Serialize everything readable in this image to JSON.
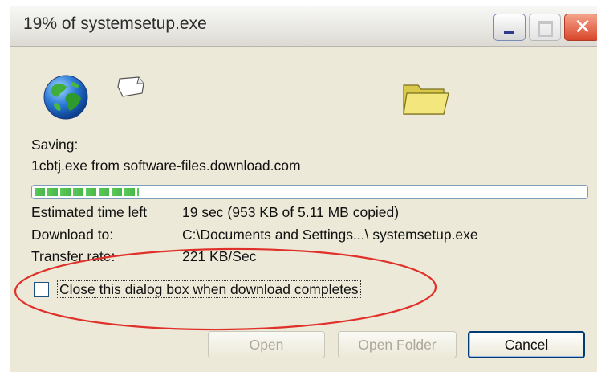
{
  "window": {
    "title": "19% of systemsetup.exe",
    "controls": {
      "minimize": "minimize",
      "maximize": "maximize",
      "close": "✕"
    }
  },
  "status": {
    "saving_label": "Saving:",
    "source": "1cbtj.exe from software-files.download.com",
    "progress_fraction": 0.19
  },
  "details": {
    "time_left_label": "Estimated time left",
    "time_left_value": "19 sec (953 KB of 5.11 MB copied)",
    "download_to_label": "Download to:",
    "download_to_value": "C:\\Documents and Settings...\\ systemsetup.exe",
    "transfer_rate_label": "Transfer rate:",
    "transfer_rate_value": "221 KB/Sec"
  },
  "options": {
    "close_when_done_label": "Close this dialog box when download completes",
    "close_when_done_checked": false
  },
  "buttons": {
    "open": "Open",
    "open_folder": "Open Folder",
    "cancel": "Cancel"
  },
  "colors": {
    "annotation_ellipse": "#e0302a",
    "progress_fill": "#4cbc4c",
    "dialog_bg": "#ece9d8"
  },
  "icons": [
    "globe-icon",
    "document-icon",
    "folder-icon"
  ]
}
